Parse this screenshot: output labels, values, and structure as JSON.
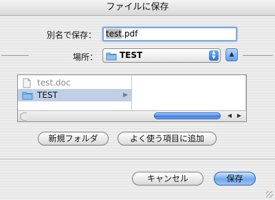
{
  "window": {
    "title": "ファイルに保存"
  },
  "save_as": {
    "label": "別名で保存：",
    "value": "test.pdf",
    "selected_part": "test",
    "rest": ".pdf"
  },
  "location": {
    "label": "場所：",
    "selected": "TEST"
  },
  "browser": {
    "items": [
      {
        "name": "test.doc",
        "kind": "document",
        "enabled": false
      },
      {
        "name": "TEST",
        "kind": "folder",
        "selected": true
      }
    ]
  },
  "buttons": {
    "new_folder": "新規フォルダ",
    "add_favorite": "よく使う項目に追加",
    "cancel": "キャンセル",
    "save": "保存"
  },
  "colors": {
    "accent": "#5f9ded",
    "selection": "#bfcfe6"
  }
}
